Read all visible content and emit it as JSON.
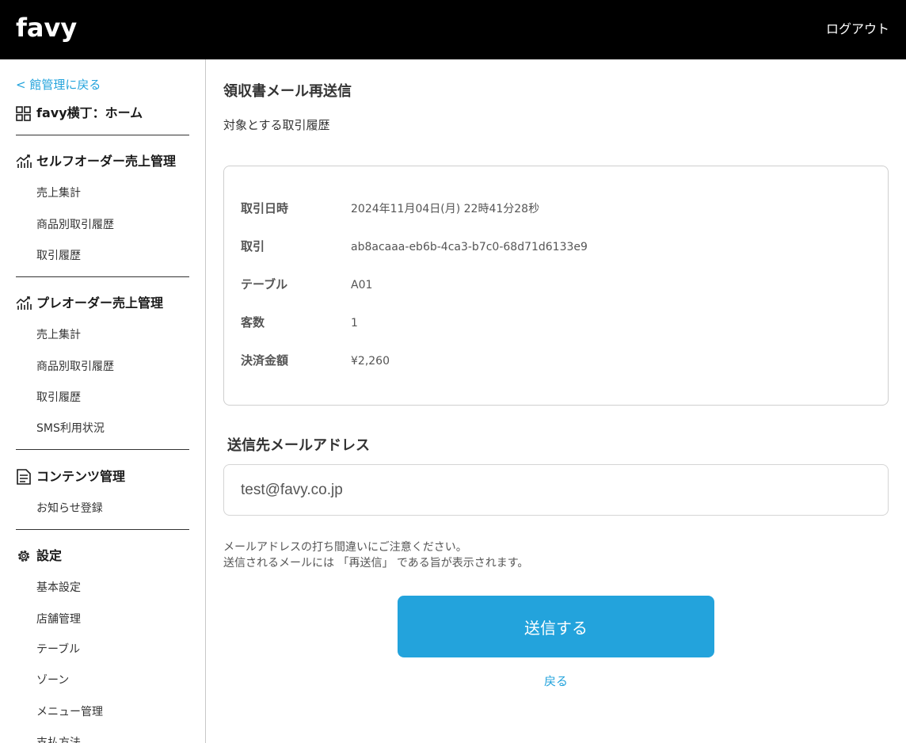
{
  "header": {
    "logo_text": "favy",
    "logout_label": "ログアウト"
  },
  "sidebar": {
    "back_link": "< 館管理に戻る",
    "home_label": "favy横丁：ホーム",
    "sections": [
      {
        "title": "セルフオーダー売上管理",
        "icon": "chart-icon",
        "items": [
          "売上集計",
          "商品別取引履歴",
          "取引履歴"
        ]
      },
      {
        "title": "プレオーダー売上管理",
        "icon": "chart-icon",
        "items": [
          "売上集計",
          "商品別取引履歴",
          "取引履歴",
          "SMS利用状況"
        ]
      },
      {
        "title": "コンテンツ管理",
        "icon": "document-icon",
        "items": [
          "お知らせ登録"
        ]
      },
      {
        "title": "設定",
        "icon": "gear-icon",
        "items": [
          "基本設定",
          "店舗管理",
          "テーブル",
          "ゾーン",
          "メニュー管理",
          "支払方法"
        ]
      }
    ]
  },
  "main": {
    "title": "領収書メール再送信",
    "subtitle": "対象とする取引履歴",
    "transaction": [
      {
        "label": "取引日時",
        "value": "2024年11月04日(月) 22時41分28秒"
      },
      {
        "label": "取引",
        "value": "ab8acaaa-eb6b-4ca3-b7c0-68d71d6133e9"
      },
      {
        "label": "テーブル",
        "value": "A01"
      },
      {
        "label": "客数",
        "value": "1"
      },
      {
        "label": "決済金額",
        "value": "¥2,260"
      }
    ],
    "email_label": "送信先メールアドレス",
    "email_value": "test@favy.co.jp",
    "note_line1": "メールアドレスの打ち間違いにご注意ください。",
    "note_line2": "送信されるメールには 「再送信」 である旨が表示されます。",
    "send_label": "送信する",
    "back_label": "戻る"
  },
  "colors": {
    "accent": "#23a3dc",
    "header_bg": "#000000"
  }
}
